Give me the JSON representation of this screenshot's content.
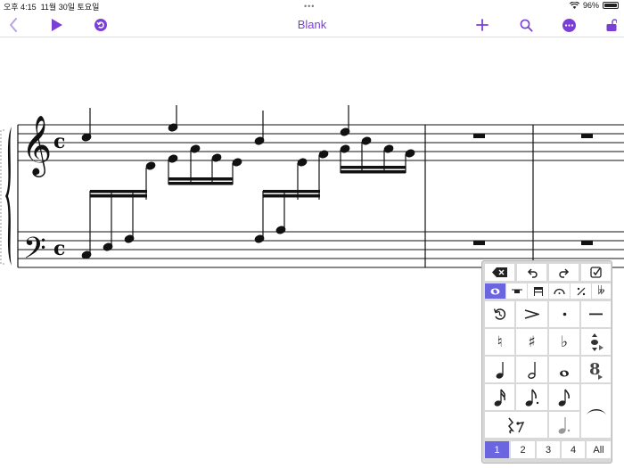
{
  "status": {
    "time": "오후 4:15",
    "date": "11월 30일 토요일",
    "battery": "96%"
  },
  "nav": {
    "title": "Blank",
    "icons": [
      "chevron-left-icon",
      "play-icon",
      "undo-circle-icon",
      "plus-icon",
      "search-icon",
      "more-icon",
      "unlock-icon"
    ]
  },
  "palette": {
    "voice_buttons": [
      "1",
      "2",
      "3",
      "4",
      "All"
    ],
    "selected_voice": "1",
    "accent_color": "#6b66e0"
  },
  "colors": {
    "accent": "#7b3fd6"
  }
}
